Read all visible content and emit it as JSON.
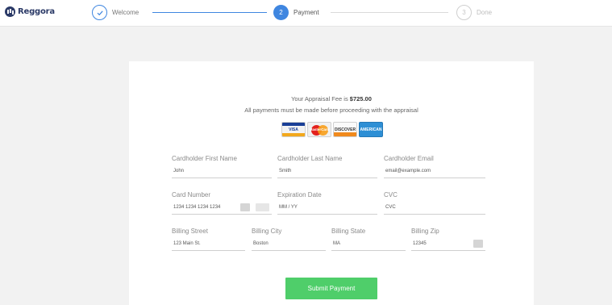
{
  "brand": {
    "name": "Reggora"
  },
  "steps": [
    {
      "number": "",
      "label": "Welcome",
      "state": "done"
    },
    {
      "number": "2",
      "label": "Payment",
      "state": "active"
    },
    {
      "number": "3",
      "label": "Done",
      "state": "todo"
    }
  ],
  "fee": {
    "prefix": "Your Appraisal Fee is ",
    "amount": "$725.00"
  },
  "notice": "All payments must be made before proceeding with the appraisal",
  "card_logos": [
    {
      "name": "visa-icon",
      "text": "VISA"
    },
    {
      "name": "mastercard-icon",
      "text": "MasterCard"
    },
    {
      "name": "discover-icon",
      "text": "DISCOVER"
    },
    {
      "name": "amex-icon",
      "text": "AMERICAN"
    }
  ],
  "form": {
    "first_name": {
      "label": "Cardholder First Name",
      "value": "John"
    },
    "last_name": {
      "label": "Cardholder Last Name",
      "value": "Smith"
    },
    "email": {
      "label": "Cardholder Email",
      "value": "email@example.com"
    },
    "card_number": {
      "label": "Card Number",
      "value": "1234 1234 1234 1234"
    },
    "expiration": {
      "label": "Expiration Date",
      "value": "MM / YY"
    },
    "cvc": {
      "label": "CVC",
      "value": "CVC"
    },
    "street": {
      "label": "Billing Street",
      "value": "123 Main St."
    },
    "city": {
      "label": "Billing City",
      "value": "Boston"
    },
    "state": {
      "label": "Billing State",
      "value": "MA"
    },
    "zip": {
      "label": "Billing Zip",
      "value": "12345"
    }
  },
  "submit_label": "Submit Payment",
  "colors": {
    "accent": "#3f86e0",
    "brand": "#2b3a67",
    "submit": "#4fce6a",
    "background": "#f2f2f2"
  }
}
